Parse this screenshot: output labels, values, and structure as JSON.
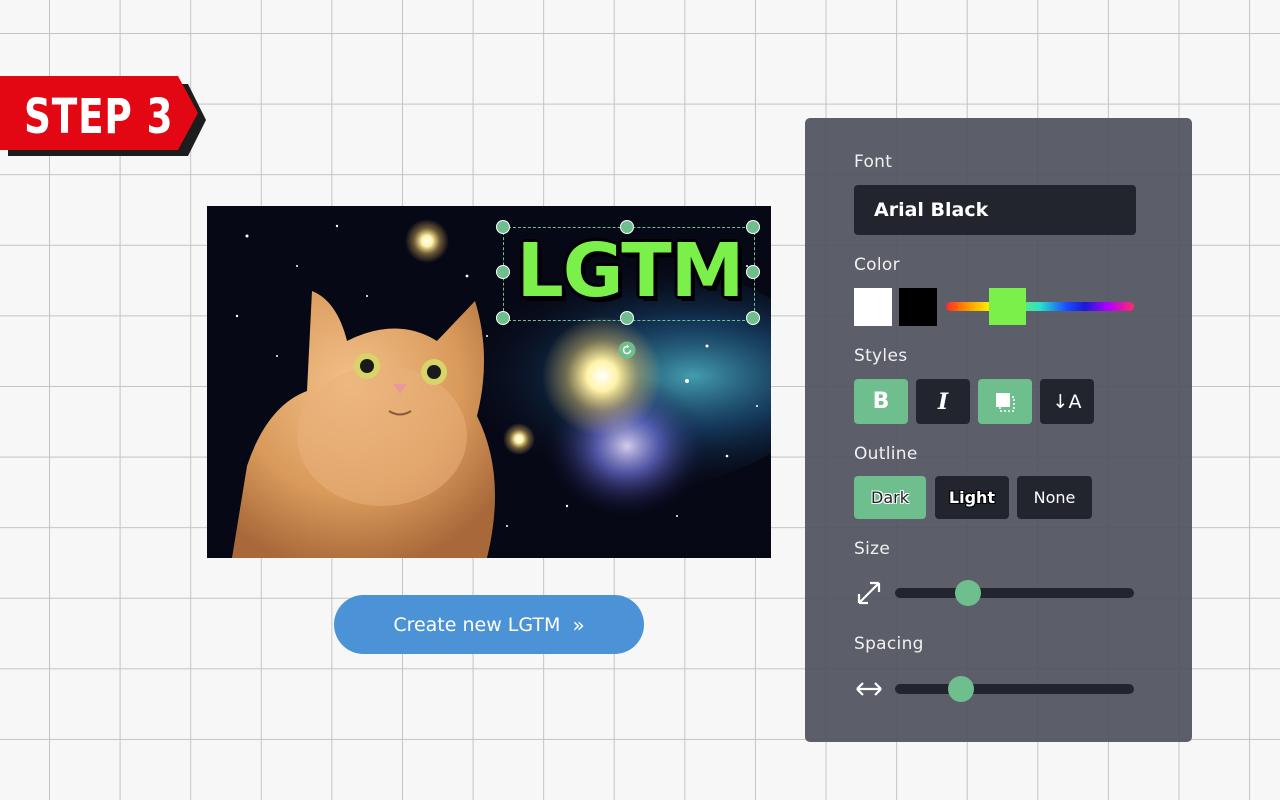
{
  "step_badge": {
    "label": "STEP 3",
    "color": "#e30613"
  },
  "canvas": {
    "overlay_text": "LGTM",
    "text_color": "#7cf04a",
    "selected": true
  },
  "create_button": {
    "label": "Create new LGTM",
    "icon": "double-chevron-right-icon"
  },
  "panel": {
    "font": {
      "label": "Font",
      "value": "Arial Black"
    },
    "color": {
      "label": "Color",
      "swatches": [
        {
          "name": "white",
          "hex": "#ffffff"
        },
        {
          "name": "black",
          "hex": "#000000"
        }
      ],
      "selected_hex": "#7cf04a"
    },
    "styles": {
      "label": "Styles",
      "buttons": [
        {
          "name": "bold",
          "glyph": "B",
          "active": true
        },
        {
          "name": "italic",
          "glyph": "I",
          "active": false
        },
        {
          "name": "shadow",
          "icon": "shadow-icon",
          "active": true
        },
        {
          "name": "vertical-text",
          "glyph": "↓A",
          "active": false
        }
      ]
    },
    "outline": {
      "label": "Outline",
      "options": [
        "Dark",
        "Light",
        "None"
      ],
      "selected": "Dark"
    },
    "size": {
      "label": "Size",
      "icon": "resize-diagonal-icon",
      "value_fraction": 0.3
    },
    "spacing": {
      "label": "Spacing",
      "icon": "horizontal-arrows-icon",
      "value_fraction": 0.28
    }
  },
  "colors": {
    "accent": "#6fbf8e",
    "button_blue": "#4b93d6",
    "panel_bg": "#4e515c",
    "control_dark": "#23252e"
  }
}
